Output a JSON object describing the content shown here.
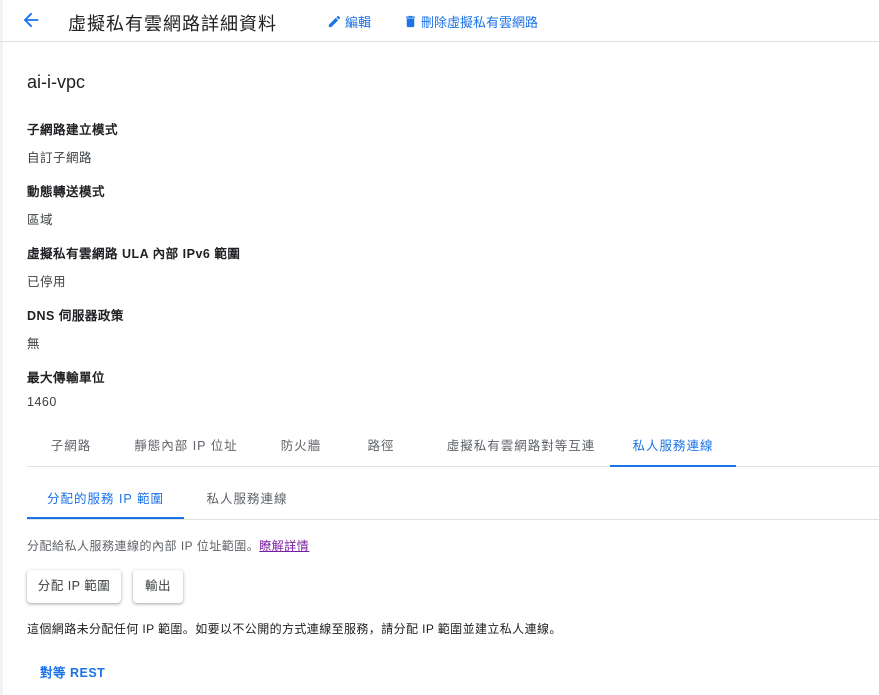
{
  "header": {
    "title": "虛擬私有雲網路詳細資料",
    "edit_label": "編輯",
    "delete_label": "刪除虛擬私有雲網路"
  },
  "vpc": {
    "name": "ai-i-vpc",
    "fields": [
      {
        "label": "子網路建立模式",
        "value": "自訂子網路"
      },
      {
        "label": "動態轉送模式",
        "value": "區域"
      },
      {
        "label": "虛擬私有雲網路 ULA 內部 IPv6 範圍",
        "value": "已停用"
      },
      {
        "label": "DNS 伺服器政策",
        "value": "無"
      },
      {
        "label": "最大傳輸單位",
        "value": "1460"
      }
    ]
  },
  "tabs": [
    {
      "label": "子網路"
    },
    {
      "label": "靜態內部 IP 位址"
    },
    {
      "label": "防火牆"
    },
    {
      "label": "路徑"
    },
    {
      "label": "虛擬私有雲網路對等互連"
    },
    {
      "label": "私人服務連線"
    }
  ],
  "active_tab": "私人服務連線",
  "subtabs": [
    {
      "label": "分配的服務 IP 範圍"
    },
    {
      "label": "私人服務連線"
    }
  ],
  "active_subtab": "分配的服務 IP 範圍",
  "panel": {
    "description": "分配給私人服務連線的內部 IP 位址範圍。",
    "learn_more": "瞭解詳情",
    "allocate_button": "分配 IP 範圍",
    "export_button": "輸出",
    "notice": "這個網路未分配任何 IP 範圍。如要以不公開的方式連線至服務，請分配 IP 範圍並建立私人連線。",
    "rest_link": "對等 REST"
  },
  "colors": {
    "accent": "#1a73e8",
    "link_visited": "#7b1fa2",
    "text": "#202124",
    "muted": "#5f6368"
  },
  "icons": [
    "back-arrow-icon",
    "pencil-icon",
    "trash-icon"
  ]
}
